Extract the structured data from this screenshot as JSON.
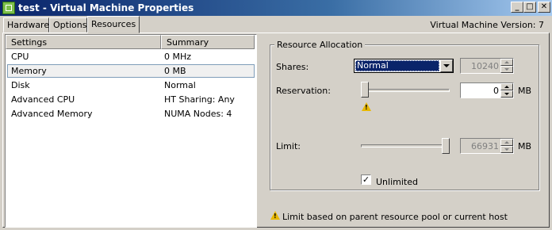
{
  "window": {
    "title": "test - Virtual Machine Properties",
    "version_label": "Virtual Machine Version: 7",
    "controls": {
      "minimize": "_",
      "maximize": "□",
      "close": "✕"
    }
  },
  "tabs": [
    {
      "label": "Hardware",
      "active": false
    },
    {
      "label": "Options",
      "active": false
    },
    {
      "label": "Resources",
      "active": true
    }
  ],
  "list": {
    "headers": {
      "settings": "Settings",
      "summary": "Summary"
    },
    "rows": [
      {
        "setting": "CPU",
        "summary": "0 MHz"
      },
      {
        "setting": "Memory",
        "summary": "0 MB",
        "selected": true
      },
      {
        "setting": "Disk",
        "summary": "Normal"
      },
      {
        "setting": "Advanced CPU",
        "summary": "HT Sharing: Any"
      },
      {
        "setting": "Advanced Memory",
        "summary": "NUMA Nodes: 4"
      }
    ]
  },
  "resource_allocation": {
    "legend": "Resource Allocation",
    "shares": {
      "label": "Shares:",
      "value": "Normal",
      "number": "10240"
    },
    "reservation": {
      "label": "Reservation:",
      "value": "0",
      "unit": "MB",
      "slider_fraction": 0.0
    },
    "limit": {
      "label": "Limit:",
      "value": "66931",
      "unit": "MB",
      "slider_fraction": 1.0
    },
    "unlimited": {
      "label": "Unlimited",
      "checked": true
    }
  },
  "footer_note": "Limit based on parent resource pool or current host",
  "colors": {
    "title_bar": "#0a246a",
    "warning": "#e8b800",
    "selection": "#0a246a"
  }
}
